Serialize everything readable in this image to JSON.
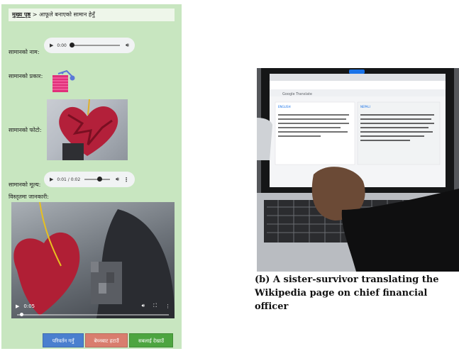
{
  "panel_a": {
    "breadcrumb": {
      "home": "मुख्य पृष्ठ",
      "separator": ">",
      "current": "आफूले बनाएको सामान हेर्नुँ"
    },
    "fields": {
      "name_label": "सामानको नाम:",
      "type_label": "सामानको प्रकार:",
      "photo_label": "सामानको फोटो:",
      "price_label": "सामानको मूल्य:",
      "details_label": "विस्तृतमा जानकारी:"
    },
    "name_audio": {
      "time": "0:00",
      "progress": 0
    },
    "price_audio": {
      "time": "0:01 / 0:02",
      "progress": 0.5
    },
    "video": {
      "time": "0:05",
      "progress": 0.02
    },
    "buttons": {
      "change": {
        "label": "परिवर्तन गर्नुँ",
        "color": "#4a7fcf"
      },
      "remove": {
        "label": "बेच्नबाट हटाउँ",
        "color": "#d97d6e"
      },
      "show_others": {
        "label": "सबलाई देखाउँ",
        "color": "#4da540"
      }
    },
    "colors": {
      "background": "#c8e6c0"
    }
  },
  "panel_b": {
    "caption": "(b) A sister-survivor translating the Wikipedia page on chief financial officer",
    "screen": {
      "app_title": "Google Translate",
      "source_lang": "ENGLISH",
      "target_lang": "NEPALI"
    }
  }
}
